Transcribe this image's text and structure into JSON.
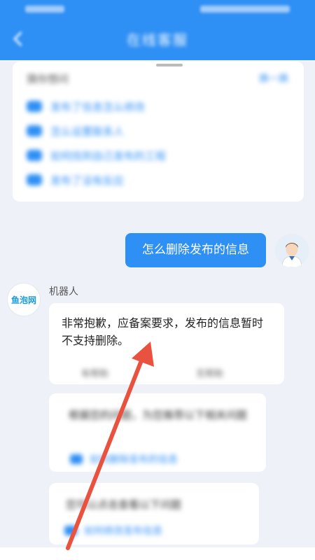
{
  "header": {
    "title": "在线客服"
  },
  "faq": {
    "title": "猜你想问",
    "more": "换一换",
    "items": [
      {
        "label": "发布了信息怎么修改"
      },
      {
        "label": "怎么设置联系人"
      },
      {
        "label": "如何找到自己发布的工程"
      },
      {
        "label": "发布了没有反应"
      }
    ]
  },
  "chat": {
    "user_message": "怎么删除发布的信息",
    "bot_name": "机器人",
    "bot_avatar_text": "鱼泡网",
    "bot_message": "非常抱歉，应备案要求，发布的信息暂时不支持删除。",
    "bot_actions": {
      "helpful": "有帮助",
      "unhelpful": "无帮助"
    },
    "suggestion_card": {
      "text": "根据您的问题，为您推荐以下相关问题",
      "link": "如何删除发布的信息"
    },
    "suggestion_card_2": {
      "text": "您可以点击查看以下问题",
      "link": "如何修改发布信息"
    }
  },
  "colors": {
    "accent": "#2e8ff4",
    "arrow": "#e8523f"
  }
}
